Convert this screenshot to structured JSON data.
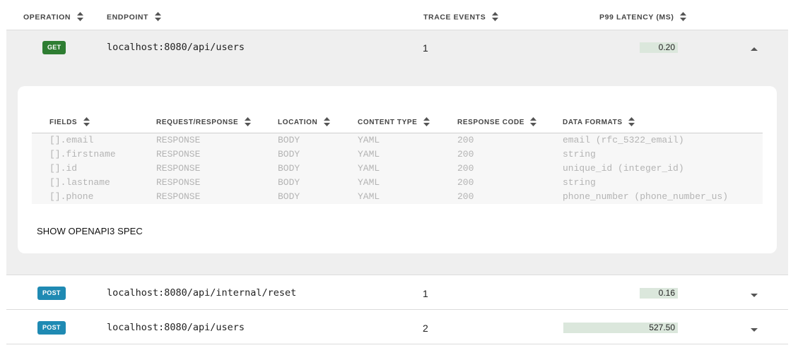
{
  "header": {
    "operation": "OPERATION",
    "endpoint": "ENDPOINT",
    "trace_events": "TRACE EVENTS",
    "p99_latency": "P99 LATENCY (MS)"
  },
  "rows": [
    {
      "method": "GET",
      "endpoint": "localhost:8080/api/users",
      "trace_events": "1",
      "latency": "0.20",
      "latency_fraction": 0.1,
      "expanded": true
    },
    {
      "method": "POST",
      "endpoint": "localhost:8080/api/internal/reset",
      "trace_events": "1",
      "latency": "0.16",
      "latency_fraction": 0.1,
      "expanded": false
    },
    {
      "method": "POST",
      "endpoint": "localhost:8080/api/users",
      "trace_events": "2",
      "latency": "527.50",
      "latency_fraction": 1.0,
      "expanded": false
    }
  ],
  "detail": {
    "columns": [
      "FIELDS",
      "REQUEST/RESPONSE",
      "LOCATION",
      "CONTENT TYPE",
      "RESPONSE CODE",
      "DATA FORMATS"
    ],
    "rows": [
      [
        "[].email",
        "RESPONSE",
        "BODY",
        "YAML",
        "200",
        "email (rfc_5322_email)"
      ],
      [
        "[].firstname",
        "RESPONSE",
        "BODY",
        "YAML",
        "200",
        "string"
      ],
      [
        "[].id",
        "RESPONSE",
        "BODY",
        "YAML",
        "200",
        "unique_id (integer_id)"
      ],
      [
        "[].lastname",
        "RESPONSE",
        "BODY",
        "YAML",
        "200",
        "string"
      ],
      [
        "[].phone",
        "RESPONSE",
        "BODY",
        "YAML",
        "200",
        "phone_number (phone_number_us)"
      ]
    ],
    "show_spec_label": "SHOW OPENAPI3 SPEC"
  },
  "colors": {
    "get_badge": "#2e7d32",
    "post_badge": "#1f8ab3",
    "latency_bar": "#dbe7dc",
    "expanded_bg": "#efefef"
  },
  "icons": {
    "sort": "sort-arrows-icon",
    "expanded": "chevron-up-icon",
    "collapsed": "chevron-down-icon"
  }
}
